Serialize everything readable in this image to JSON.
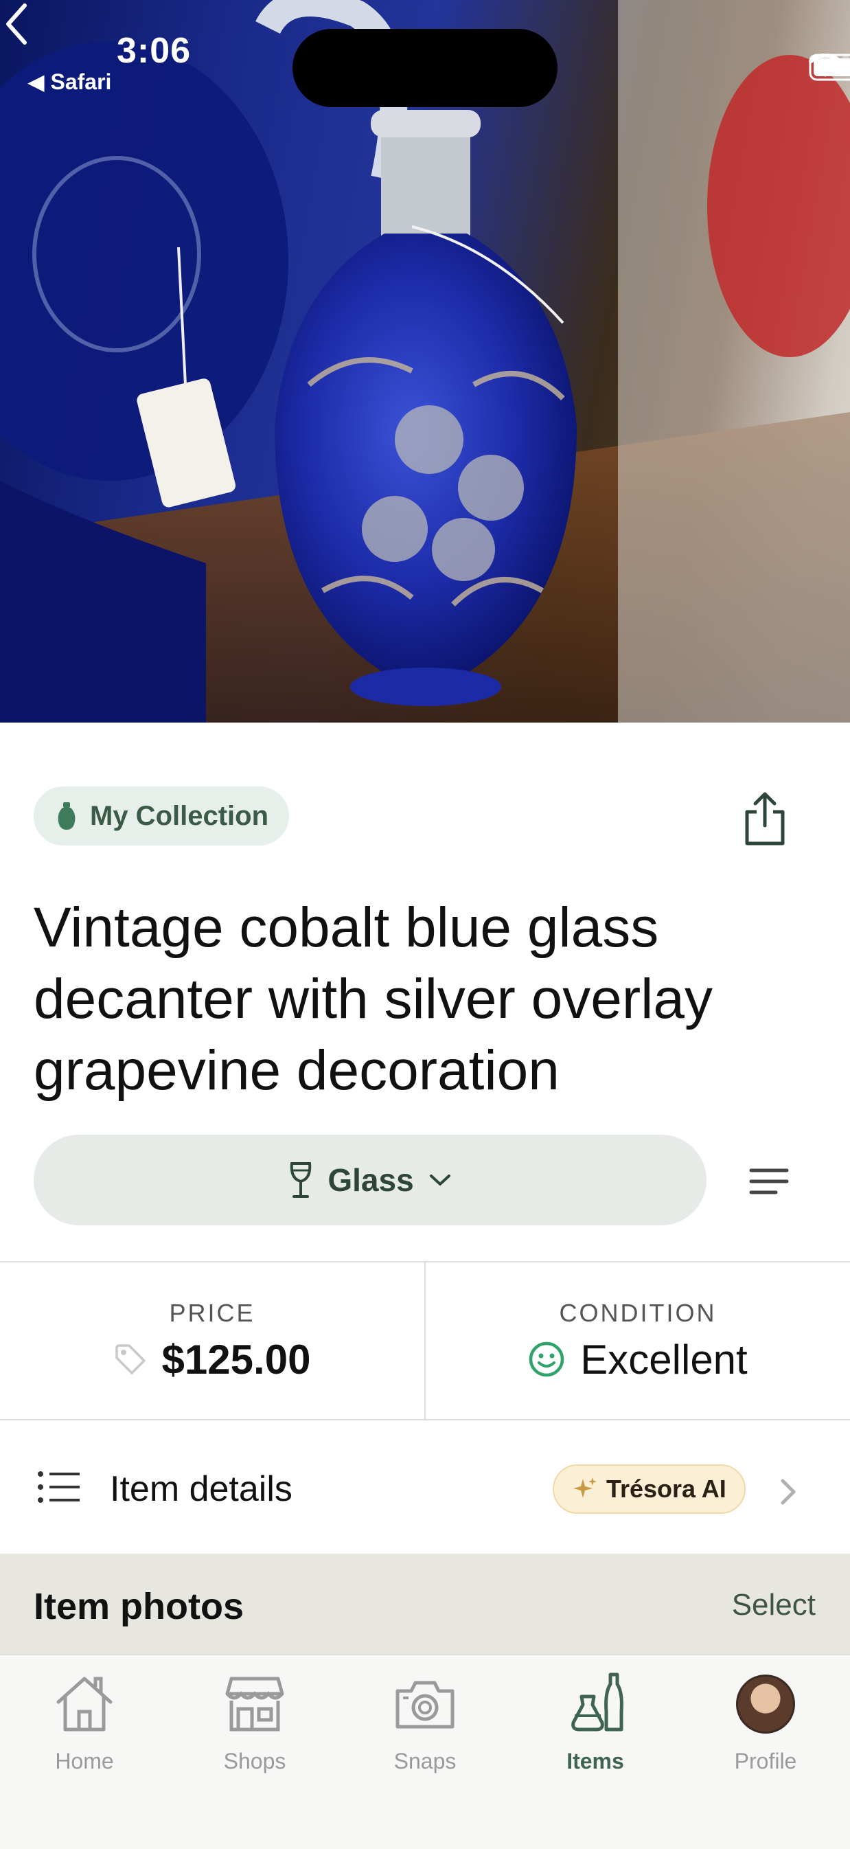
{
  "status_bar": {
    "time": "3:06",
    "back_app": "Safari"
  },
  "chip": {
    "label": "My Collection"
  },
  "item": {
    "title": "Vintage cobalt blue glass decanter with silver overlay grapevine decoration",
    "category": "Glass"
  },
  "stats": {
    "price_label": "PRICE",
    "price_value": "$125.00",
    "condition_label": "CONDITION",
    "condition_value": "Excellent"
  },
  "details": {
    "label": "Item details",
    "ai_badge": "Trésora AI"
  },
  "photos": {
    "title": "Item photos",
    "select": "Select"
  },
  "tabs": [
    {
      "label": "Home",
      "icon": "house-icon"
    },
    {
      "label": "Shops",
      "icon": "storefront-icon"
    },
    {
      "label": "Snaps",
      "icon": "camera-icon"
    },
    {
      "label": "Items",
      "icon": "vases-icon",
      "active": true
    },
    {
      "label": "Profile",
      "icon": "avatar"
    }
  ],
  "colors": {
    "accent": "#3f6453",
    "chip_bg": "#e6efe9",
    "ai_badge_bg": "#fbf0d6",
    "success": "#2fa46a"
  }
}
